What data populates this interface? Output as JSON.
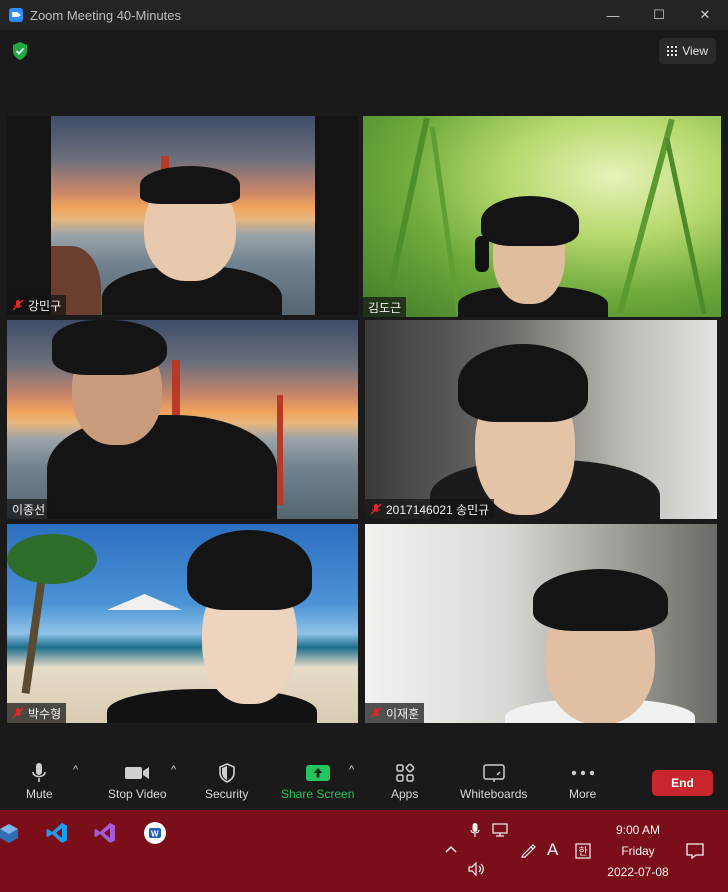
{
  "window": {
    "title": "Zoom Meeting 40-Minutes",
    "controls": {
      "minimize": "—",
      "maximize": "☐",
      "close": "✕"
    }
  },
  "top": {
    "view_label": "View"
  },
  "participants": [
    {
      "name": "강민구",
      "muted": true,
      "active": false,
      "background": "golden-gate-bridge"
    },
    {
      "name": "김도근",
      "muted": false,
      "active": true,
      "background": "grass-dew"
    },
    {
      "name": "이종선",
      "muted": false,
      "active": false,
      "background": "golden-gate-bridge"
    },
    {
      "name": "2017146021 송민규",
      "muted": true,
      "active": false,
      "background": "room-blur"
    },
    {
      "name": "박수형",
      "muted": true,
      "active": false,
      "background": "beach-resort"
    },
    {
      "name": "이재훈",
      "muted": true,
      "active": false,
      "background": "room-blur"
    }
  ],
  "toolbar": {
    "mute": "Mute",
    "stop_video": "Stop Video",
    "security": "Security",
    "share_screen": "Share Screen",
    "apps": "Apps",
    "whiteboards": "Whiteboards",
    "more": "More",
    "end": "End"
  },
  "colors": {
    "active_speaker": "#c9e063",
    "share_green": "#22c55e",
    "end_red": "#c8262c",
    "taskbar": "#7a0f1a",
    "muted_red": "#e02828"
  },
  "taskbar": {
    "apps": [
      "virtualbox-icon",
      "vscode-icon",
      "visual-studio-icon",
      "zoom-like-icon"
    ],
    "tray_icons": [
      "chevron-up-icon",
      "microphone-icon",
      "network-icon",
      "volume-icon",
      "pen-icon",
      "font-a-icon",
      "ime-icon",
      "notification-icon"
    ],
    "font_indicator": "A",
    "time": "9:00 AM",
    "day": "Friday",
    "date": "2022-07-08"
  }
}
